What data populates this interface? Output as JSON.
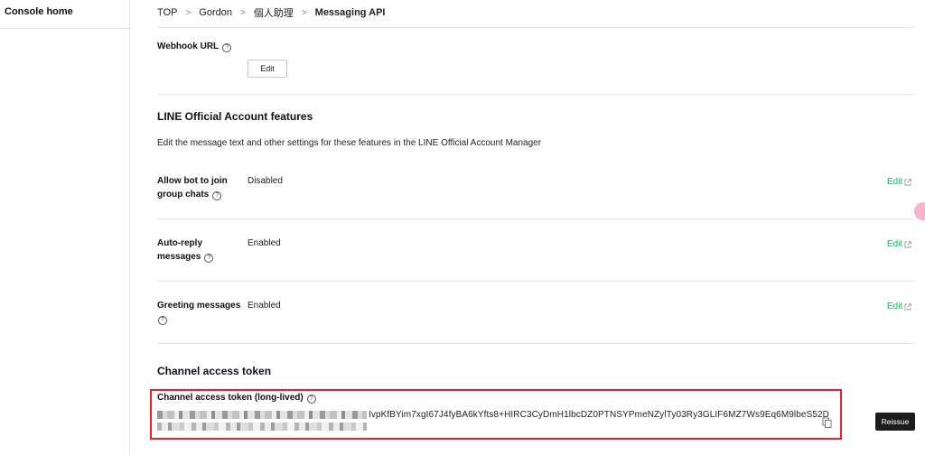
{
  "sidebar": {
    "home": "Console home"
  },
  "breadcrumb": {
    "items": [
      "TOP",
      "Gordon",
      "個人助理"
    ],
    "separator": ">",
    "current": "Messaging API"
  },
  "webhook": {
    "label": "Webhook URL",
    "help": "?",
    "edit": "Edit"
  },
  "features": {
    "title": "LINE Official Account features",
    "description": "Edit the message text and other settings for these features in the LINE Official Account Manager",
    "rows": [
      {
        "label_line1": "Allow bot to join",
        "label_line2": "group chats",
        "value": "Disabled",
        "edit": "Edit"
      },
      {
        "label_line1": "Auto-reply",
        "label_line2": "messages",
        "value": "Enabled",
        "edit": "Edit"
      },
      {
        "label_line1": "Greeting messages",
        "label_line2": "",
        "value": "Enabled",
        "edit": "Edit"
      }
    ]
  },
  "token": {
    "section_title": "Channel access token",
    "label": "Channel access token (long-lived)",
    "help": "?",
    "visible_part": "IvpKfBYim7xgI67J4fyBA6kYfts8+HIRC3CyDmH1lbcDZ0PTNSYPmeNZylTy03Ry3GLIF6MZ7Ws9Eq6M9lbeS52D",
    "reissue": "Reissue"
  },
  "colors": {
    "accent_green": "#06c755",
    "highlight_red": "#e8202a",
    "dark_button": "#1c1c1c"
  },
  "icons": {
    "help": "help-circle-icon",
    "external": "external-link-icon",
    "copy": "copy-icon"
  }
}
